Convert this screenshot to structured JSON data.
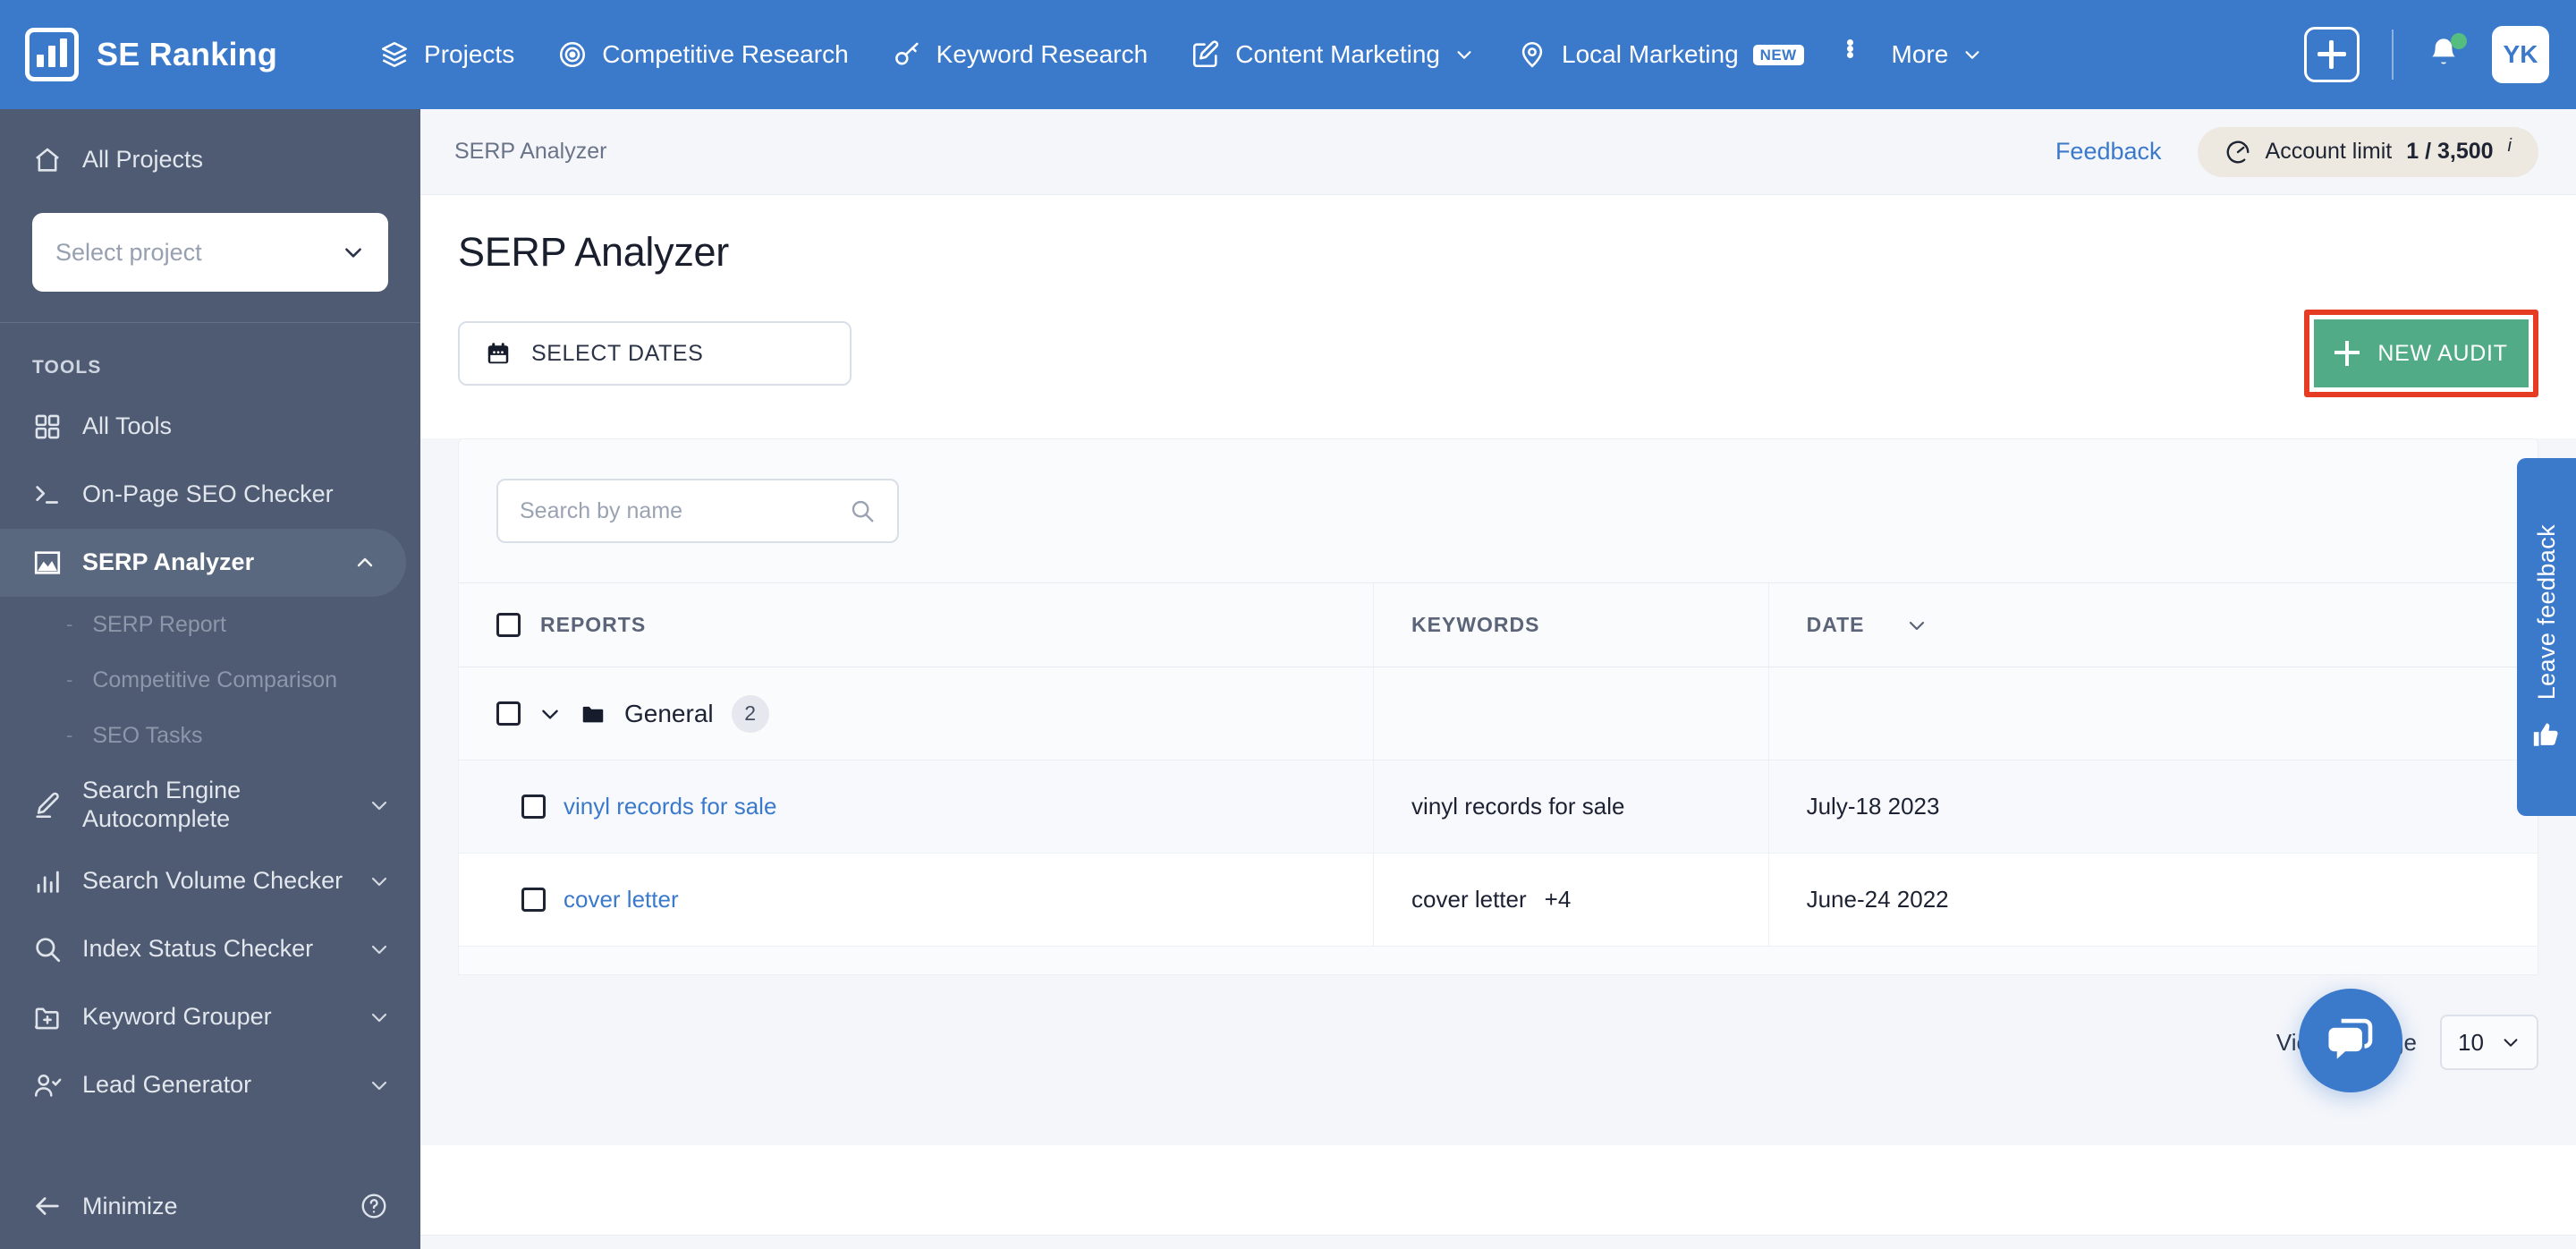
{
  "topnav": {
    "brand": "SE Ranking",
    "items": [
      {
        "label": "Projects",
        "icon": "layers-icon",
        "caret": false,
        "badge": null
      },
      {
        "label": "Competitive Research",
        "icon": "target-icon",
        "caret": false,
        "badge": null
      },
      {
        "label": "Keyword Research",
        "icon": "key-icon",
        "caret": false,
        "badge": null
      },
      {
        "label": "Content Marketing",
        "icon": "edit-square-icon",
        "caret": true,
        "badge": null
      },
      {
        "label": "Local Marketing",
        "icon": "map-pin-icon",
        "caret": false,
        "badge": "NEW"
      },
      {
        "label": "More",
        "icon": "ellipsis-icon",
        "caret": true,
        "badge": null
      }
    ],
    "add_button": "+",
    "avatar_initials": "YK",
    "accent_color": "#3b79cb"
  },
  "sidebar": {
    "all_projects": "All Projects",
    "project_placeholder": "Select project",
    "tools_caption": "TOOLS",
    "items": [
      {
        "label": "All Tools",
        "icon": "grid-icon",
        "caret": false,
        "active": false
      },
      {
        "label": "On-Page SEO Checker",
        "icon": "terminal-icon",
        "caret": false,
        "active": false
      },
      {
        "label": "SERP Analyzer",
        "icon": "image-chart-icon",
        "caret": true,
        "caret_dir": "up",
        "active": true
      },
      {
        "label": "Search Engine Autocomplete",
        "icon": "pencil-icon",
        "caret": true,
        "caret_dir": "down",
        "active": false
      },
      {
        "label": "Search Volume Checker",
        "icon": "bar-chart-icon",
        "caret": true,
        "caret_dir": "down",
        "active": false
      },
      {
        "label": "Index Status Checker",
        "icon": "search-icon",
        "caret": true,
        "caret_dir": "down",
        "active": false
      },
      {
        "label": "Keyword Grouper",
        "icon": "folder-plus-icon",
        "caret": true,
        "caret_dir": "down",
        "active": false
      },
      {
        "label": "Lead Generator",
        "icon": "user-check-icon",
        "caret": true,
        "caret_dir": "down",
        "active": false
      }
    ],
    "subitems": [
      "SERP Report",
      "Competitive Comparison",
      "SEO Tasks"
    ],
    "minimize": "Minimize",
    "background_color": "#4e5b73"
  },
  "breadcrumb": {
    "text": "SERP Analyzer",
    "feedback": "Feedback",
    "account_limit_label": "Account limit",
    "account_limit_value": "1 / 3,500",
    "info_mark": "i"
  },
  "page": {
    "title": "SERP Analyzer",
    "select_dates": "SELECT DATES",
    "new_audit": "NEW AUDIT",
    "new_audit_color": "#52ab87",
    "annotation_color": "#e63c23"
  },
  "search": {
    "placeholder": "Search by name",
    "value": ""
  },
  "table": {
    "columns": [
      "REPORTS",
      "KEYWORDS",
      "DATE"
    ],
    "sort_column": "DATE",
    "group": {
      "name": "General",
      "count": "2",
      "expanded": true
    },
    "rows": [
      {
        "report": "vinyl records for sale",
        "keywords": "vinyl records for sale",
        "extra": "",
        "date": "July-18 2023"
      },
      {
        "report": "cover letter",
        "keywords": "cover letter",
        "extra": "+4",
        "date": "June-24 2022"
      }
    ]
  },
  "footer": {
    "view_label": "View on page",
    "per_page": "10"
  },
  "widgets": {
    "feedback_tab": "Leave feedback",
    "chat": "chat-icon"
  }
}
